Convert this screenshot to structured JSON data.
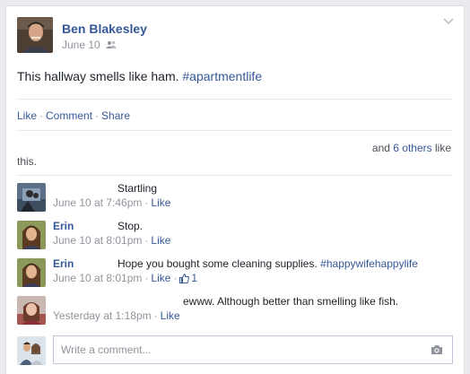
{
  "post": {
    "author": "Ben Blakesley",
    "date": "June 10",
    "privacy_icon": "friends-icon",
    "text": "This hallway smells like ham.",
    "hashtag": "#apartmentlife"
  },
  "actions": {
    "like": "Like",
    "comment": "Comment",
    "share": "Share"
  },
  "likes": {
    "and": "and",
    "others_link": "6 others",
    "like_word": "like",
    "this": "this."
  },
  "comments": [
    {
      "name": "",
      "text": "Startling",
      "time": "June 10 at 7:46pm",
      "like": "Like"
    },
    {
      "name": "Erin",
      "text": "Stop.",
      "time": "June 10 at 8:01pm",
      "like": "Like"
    },
    {
      "name": "Erin",
      "text": "Hope you bought some cleaning supplies.",
      "hashtag": "#happywifehappylife",
      "time": "June 10 at 8:01pm",
      "like": "Like",
      "like_count": "1"
    },
    {
      "name": "",
      "text": "ewww. Although better than smelling like fish.",
      "time": "Yesterday at 1:18pm",
      "like": "Like"
    }
  ],
  "composer": {
    "placeholder": "Write a comment..."
  }
}
